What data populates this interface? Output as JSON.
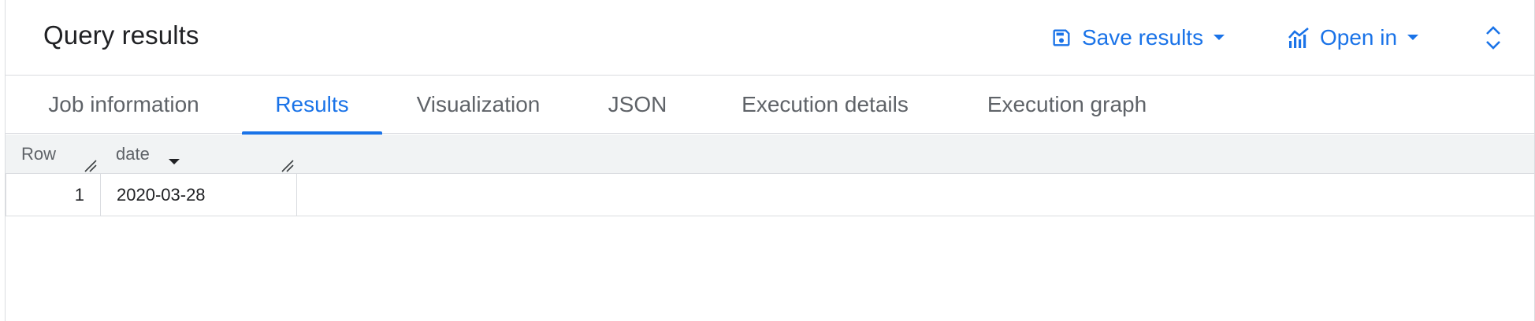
{
  "header": {
    "title": "Query results",
    "save_results_label": "Save results",
    "open_in_label": "Open in"
  },
  "tabs": [
    {
      "label": "Job information",
      "active": false
    },
    {
      "label": "Results",
      "active": true
    },
    {
      "label": "Visualization",
      "active": false
    },
    {
      "label": "JSON",
      "active": false
    },
    {
      "label": "Execution details",
      "active": false
    },
    {
      "label": "Execution graph",
      "active": false
    }
  ],
  "table": {
    "columns": [
      "Row",
      "date"
    ],
    "rows": [
      {
        "row": "1",
        "date": "2020-03-28"
      }
    ]
  },
  "icons": {
    "save": "save-icon",
    "open_in": "chart-icon",
    "expand": "unfold-icon"
  },
  "colors": {
    "accent": "#1a73e8",
    "text_muted": "#5f6368",
    "border": "#dadce0",
    "header_bg": "#f1f3f4"
  }
}
